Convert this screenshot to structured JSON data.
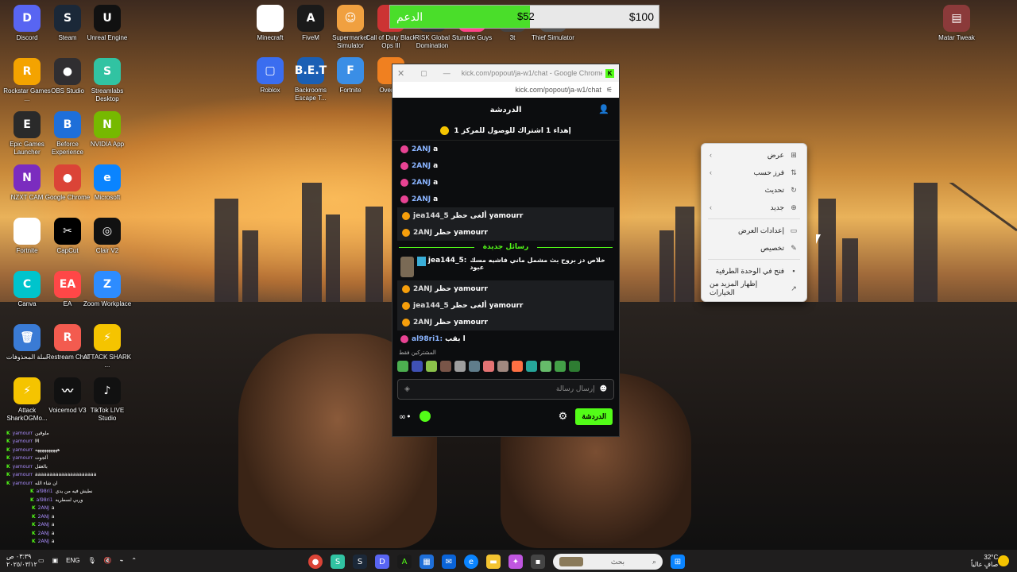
{
  "desktop_icons": [
    {
      "label": "Discord",
      "color": "#5865f2",
      "glyph": "D"
    },
    {
      "label": "Steam",
      "color": "#1b2838",
      "glyph": "S"
    },
    {
      "label": "Unreal Engine",
      "color": "#111111",
      "glyph": "U"
    },
    {
      "label": "Rockstar Games ...",
      "color": "#f4a300",
      "glyph": "R"
    },
    {
      "label": "OBS Studio",
      "color": "#302e31",
      "glyph": "●"
    },
    {
      "label": "Streamlabs Desktop",
      "color": "#31c3a2",
      "glyph": "S"
    },
    {
      "label": "Epic Games Launcher",
      "color": "#2a2a2a",
      "glyph": "E"
    },
    {
      "label": "Beforce Experience",
      "color": "#1e6fd9",
      "glyph": "B"
    },
    {
      "label": "NVIDIA App",
      "color": "#76b900",
      "glyph": "N"
    },
    {
      "label": "NZXT CAM",
      "color": "#7b2cbf",
      "glyph": "N"
    },
    {
      "label": "Google Chrome",
      "color": "#db4437",
      "glyph": "●"
    },
    {
      "label": "Microsoft",
      "color": "#0a84ff",
      "glyph": "e"
    },
    {
      "label": "Fortnite",
      "color": "#ffffff",
      "glyph": ""
    },
    {
      "label": "CapCut",
      "color": "#000000",
      "glyph": "✂"
    },
    {
      "label": "Clair V2",
      "color": "#111111",
      "glyph": "◎"
    },
    {
      "label": "Canva",
      "color": "#00c4cc",
      "glyph": "C"
    },
    {
      "label": "EA",
      "color": "#ff4747",
      "glyph": "EA"
    },
    {
      "label": "Zoom Workplace",
      "color": "#2d8cff",
      "glyph": "Z"
    },
    {
      "label": "سلة المحذوفات",
      "color": "#3a7bd5",
      "glyph": "🗑"
    },
    {
      "label": "Restream Chat",
      "color": "#f35b4f",
      "glyph": "R"
    },
    {
      "label": "ATTACK SHARK ...",
      "color": "#f5c400",
      "glyph": "⚡"
    },
    {
      "label": "Attack SharkOGMo...",
      "color": "#f5c400",
      "glyph": "⚡"
    },
    {
      "label": "Voicemod V3",
      "color": "#111111",
      "glyph": "〰"
    },
    {
      "label": "TikTok LIVE Studio",
      "color": "#111111",
      "glyph": "♪"
    }
  ],
  "top_icons": [
    {
      "label": "Minecraft",
      "color": "#ffffff",
      "glyph": ""
    },
    {
      "label": "FiveM",
      "color": "#1a1a1a",
      "glyph": "A"
    },
    {
      "label": "Supermarket Simulator",
      "color": "#f0a040",
      "glyph": "☺"
    },
    {
      "label": "Call of Duty Black Ops III",
      "color": "#c33",
      "glyph": ""
    },
    {
      "label": "RISK Global Domination",
      "color": "#333",
      "glyph": ""
    },
    {
      "label": "Stumble Guys",
      "color": "#f48",
      "glyph": ""
    },
    {
      "label": "3t",
      "color": "#444",
      "glyph": ""
    },
    {
      "label": "Thief Simulator",
      "color": "#555",
      "glyph": ""
    },
    {
      "label": "Roblox",
      "color": "#3a6df0",
      "glyph": "▢"
    },
    {
      "label": "Backrooms Escape T...",
      "color": "#1a5fb4",
      "glyph": "B.E.T"
    },
    {
      "label": "Fortnite",
      "color": "#3a8ee6",
      "glyph": "F"
    },
    {
      "label": "Overw...",
      "color": "#f08020",
      "glyph": ""
    }
  ],
  "winrar": {
    "label": "Matar Tweak",
    "color": "#8b3a3a"
  },
  "donation": {
    "label": "الدعم",
    "current": "$52",
    "goal": "$100",
    "progress": 0.52
  },
  "chat_window": {
    "title": "kick.com/popout/ja-w1/chat - Google Chrome",
    "url": "kick.com/popout/ja-w1/chat",
    "header": "الدردشة",
    "pinned": "إهداء 1 اشتراك للوصول للمركز 1",
    "messages": [
      {
        "user": "2ANJ",
        "text": "a",
        "badge": "#e84393",
        "hl": false
      },
      {
        "user": "2ANJ",
        "text": "a",
        "badge": "#e84393",
        "hl": false
      },
      {
        "user": "2ANJ",
        "text": "a",
        "badge": "#e84393",
        "hl": false
      },
      {
        "user": "2ANJ",
        "text": "a",
        "badge": "#e84393",
        "hl": false
      },
      {
        "user": "jea144_5",
        "text": "ألغى حظر yamourr",
        "badge": "#f59e0b",
        "hl": true
      },
      {
        "user": "2ANJ",
        "text": "حظر yamourr",
        "badge": "#f59e0b",
        "hl": true
      }
    ],
    "new_messages": "رسائل جديدة",
    "featured": {
      "user": "jea144_5:",
      "text": "خلاص دز بروح بث مشمل ماني فاشيه مسك عبود"
    },
    "messages2": [
      {
        "user": "2ANJ",
        "text": "حظر yamourr",
        "badge": "#f59e0b",
        "hl": true
      },
      {
        "user": "jea144_5",
        "text": "ألغى حظر yamourr",
        "badge": "#f59e0b",
        "hl": true
      },
      {
        "user": "2ANJ",
        "text": "حظر yamourr",
        "badge": "#f59e0b",
        "hl": true
      },
      {
        "user": "al98ri1:",
        "text": "ا بقب",
        "badge": "#e84393",
        "hl": false
      }
    ],
    "emote_label": "المشتركين فقط",
    "input_placeholder": "إرسال رسالة",
    "send_button": "الدردشة"
  },
  "context_menu": {
    "items": [
      {
        "label": "عرض",
        "icon": "grid-icon",
        "glyph": "⊞",
        "arrow": true
      },
      {
        "label": "فرز حسب",
        "icon": "sort-icon",
        "glyph": "⇅",
        "arrow": true
      },
      {
        "label": "تحديث",
        "icon": "refresh-icon",
        "glyph": "↻",
        "arrow": false
      },
      {
        "label": "جديد",
        "icon": "new-icon",
        "glyph": "⊕",
        "arrow": true
      },
      {
        "label": "إعدادات العرض",
        "icon": "display-icon",
        "glyph": "▭",
        "arrow": false
      },
      {
        "label": "تخصيص",
        "icon": "pen-icon",
        "glyph": "✎",
        "arrow": false
      },
      {
        "label": "فتح في الوحدة الطرفية",
        "icon": "terminal-icon",
        "glyph": "▪",
        "arrow": false
      },
      {
        "label": "إظهار المزيد من الخيارات",
        "icon": "more-icon",
        "glyph": "↗",
        "arrow": false
      }
    ]
  },
  "overlay_chat": [
    {
      "user": "yamourr",
      "text": "ملوقين"
    },
    {
      "user": "yamourr",
      "text": "M"
    },
    {
      "user": "yamourr",
      "text": "ههههههههههه"
    },
    {
      "user": "yamourr",
      "text": "ألجوت"
    },
    {
      "user": "yamourr",
      "text": "بالعقل"
    },
    {
      "user": "yamourr",
      "text": "aaaaaaaaaaaaaaaaaaaaa"
    },
    {
      "user": "yamourr",
      "text": "ان شاء الله"
    },
    {
      "user": "al98ri1",
      "text": "نطيش فيه من يدي"
    },
    {
      "user": "al98ri1",
      "text": "وربي لسطريه"
    },
    {
      "user": "2ANJ",
      "text": "a"
    },
    {
      "user": "2ANJ",
      "text": "a"
    },
    {
      "user": "2ANJ",
      "text": "a"
    },
    {
      "user": "2ANJ",
      "text": "a"
    },
    {
      "user": "2ANJ",
      "text": "a"
    }
  ],
  "taskbar": {
    "search_placeholder": "بحث",
    "lang": "ENG",
    "time": "٠٣:٣٩ ص",
    "date": "٢٠٢٥/٠٣/١٢",
    "weather_temp": "32°C",
    "weather_text": "صافٍ عالياً"
  }
}
